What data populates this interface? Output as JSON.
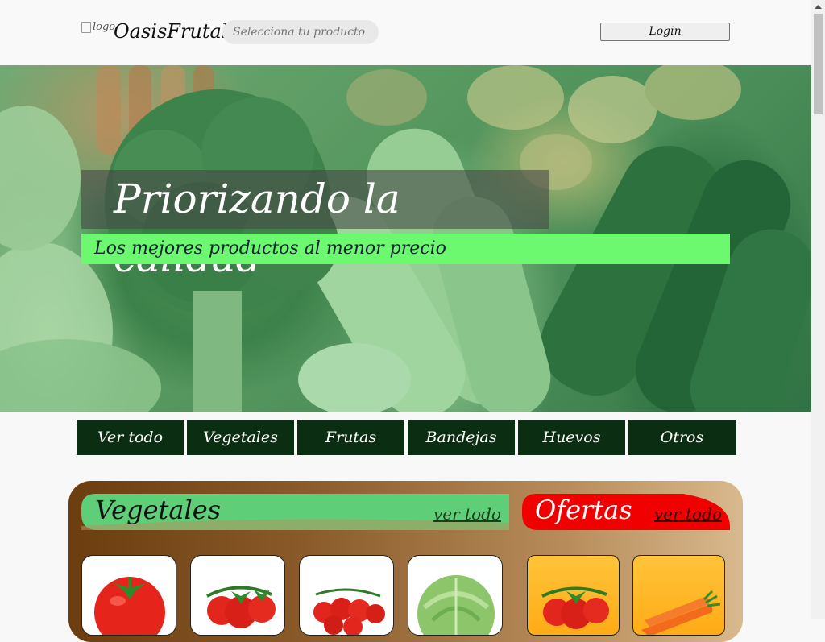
{
  "header": {
    "logo_alt": "logo",
    "brand": "OasisFrutal",
    "search_placeholder": "Selecciona tu producto",
    "login_label": "Login"
  },
  "hero": {
    "title": "Priorizando la calidad",
    "subtitle": "Los mejores productos al menor precio"
  },
  "categories": [
    "Ver todo",
    "Vegetales",
    "Frutas",
    "Bandejas",
    "Huevos",
    "Otros"
  ],
  "sections": {
    "vegetales": {
      "title": "Vegetales",
      "link": "ver todo",
      "color": "#5ecf78"
    },
    "ofertas": {
      "title": "Ofertas",
      "link": "ver todo",
      "color": "#f00000"
    }
  },
  "products": [
    "tomato",
    "tomato-vine",
    "cherry-tomato",
    "lettuce"
  ],
  "offers": [
    "tomato-vine",
    "carrot"
  ],
  "colors": {
    "tab_bg": "#0b2e12",
    "subtitle_bg": "#6cf86f"
  }
}
